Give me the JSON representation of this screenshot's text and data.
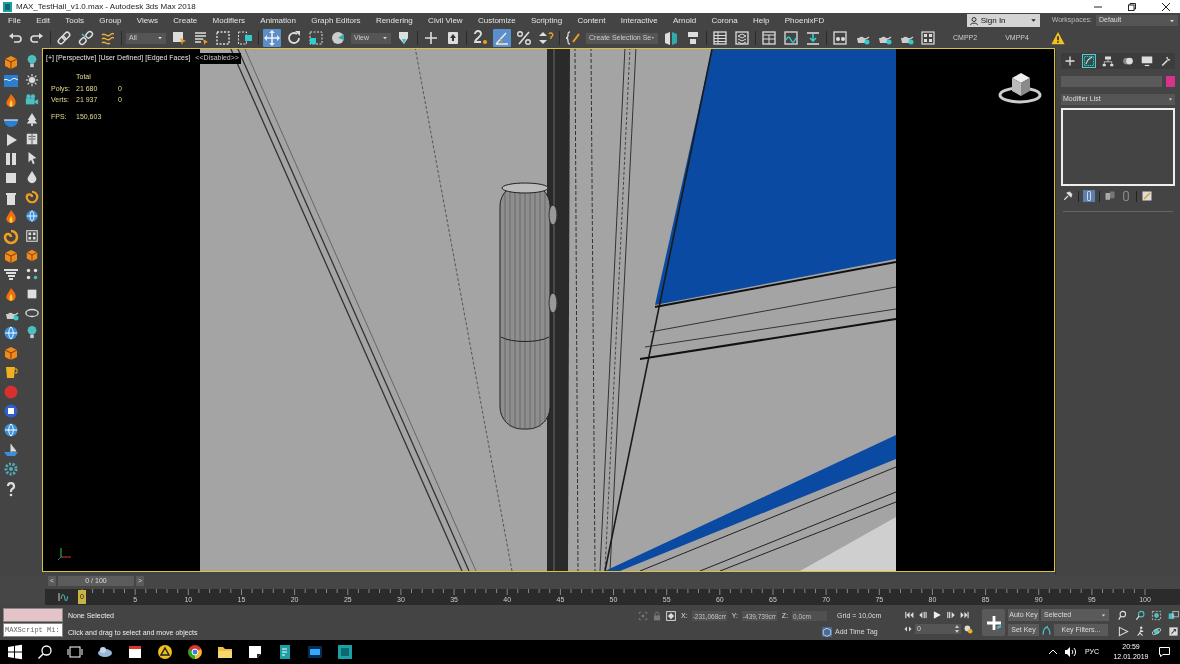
{
  "window": {
    "title": "MAX_TestHall_v1.0.max - Autodesk 3ds Max 2018"
  },
  "menu": [
    "File",
    "Edit",
    "Tools",
    "Group",
    "Views",
    "Create",
    "Modifiers",
    "Animation",
    "Graph Editors",
    "Rendering",
    "Civil View",
    "Customize",
    "Scripting",
    "Content",
    "Interactive",
    "Arnold",
    "Corona",
    "Help",
    "PhoenixFD"
  ],
  "account": {
    "label": "Sign In"
  },
  "workspaces": {
    "label": "Workspaces:",
    "value": "Default"
  },
  "toolbar": {
    "filter": "All",
    "coordinate_system": "View",
    "selection_set": "Create Selection Se",
    "labels": [
      "CMPP2",
      "VMPP4"
    ],
    "tools": [
      {
        "selected": false
      },
      {
        "selected": false
      },
      {
        "selected": false
      },
      {
        "selected": false
      },
      {
        "selected": false
      },
      {
        "selected": false
      },
      {
        "selected": false
      },
      {
        "selected": false
      },
      {
        "selected": false
      },
      {
        "selected": true
      },
      {
        "selected": false
      },
      {
        "selected": false
      },
      {
        "selected": false
      },
      {
        "selected": false
      },
      {
        "selected": false
      },
      {
        "selected": false
      },
      {
        "selected": false
      },
      {
        "selected": true
      },
      {
        "selected": false
      },
      {
        "selected": false
      },
      {
        "selected": false
      },
      {
        "selected": false
      },
      {
        "selected": false
      },
      {
        "selected": false
      },
      {
        "selected": false
      },
      {
        "selected": false
      },
      {
        "selected": false
      },
      {
        "selected": false
      },
      {
        "selected": false
      },
      {
        "selected": false
      },
      {
        "selected": false
      },
      {
        "selected": false
      },
      {
        "selected": false
      }
    ]
  },
  "viewport": {
    "labels": [
      "[+]",
      "[Perspective]",
      "[User Defined]",
      "[Edged Faces]"
    ],
    "disabled_label": "<<Disabled>>",
    "stats": {
      "header": "Total",
      "rows": [
        {
          "label": "Polys:",
          "total": "21 680",
          "selected": "0"
        },
        {
          "label": "Verts:",
          "total": "21 937",
          "selected": "0"
        }
      ],
      "fps_label": "FPS:",
      "fps": "150,603"
    }
  },
  "command_panel": {
    "tabs": [
      {
        "selected": false
      },
      {
        "selected": true
      },
      {
        "selected": false
      },
      {
        "selected": false
      },
      {
        "selected": false
      },
      {
        "selected": false
      }
    ],
    "modifier_list": "Modifier List",
    "stack_tools": [
      {
        "selected": false
      },
      {
        "selected": true
      },
      {
        "selected": false
      },
      {
        "selected": false
      },
      {
        "selected": false
      }
    ]
  },
  "timeline": {
    "level": 0,
    "prev": "<",
    "frame": "0 / 100",
    "next": ">",
    "marker": "0",
    "ticks": [
      "5",
      "10",
      "15",
      "20",
      "25",
      "30",
      "35",
      "40",
      "45",
      "50",
      "55",
      "60",
      "65",
      "70",
      "75",
      "80",
      "85",
      "90",
      "95",
      "100"
    ]
  },
  "status": {
    "maxscript": "MAXScript Mi:",
    "selection": "None Selected",
    "prompt": "Click and drag to select and move objects",
    "x_label": "X:",
    "x": "-231,068cm",
    "y_label": "Y:",
    "y": "-439,739cm",
    "z_label": "Z:",
    "z": "0,0cm",
    "grid": "Grid = 10,0cm",
    "time_tag": "Add Time Tag",
    "current_frame": "0",
    "auto_key": {
      "label": "Auto Key",
      "on": false
    },
    "key_mode": "Selected",
    "set_key": "Set Key",
    "key_filters": "Key Filters..."
  },
  "taskbar": {
    "language": "РУС",
    "time": "20:59",
    "date": "12.01.2019"
  }
}
